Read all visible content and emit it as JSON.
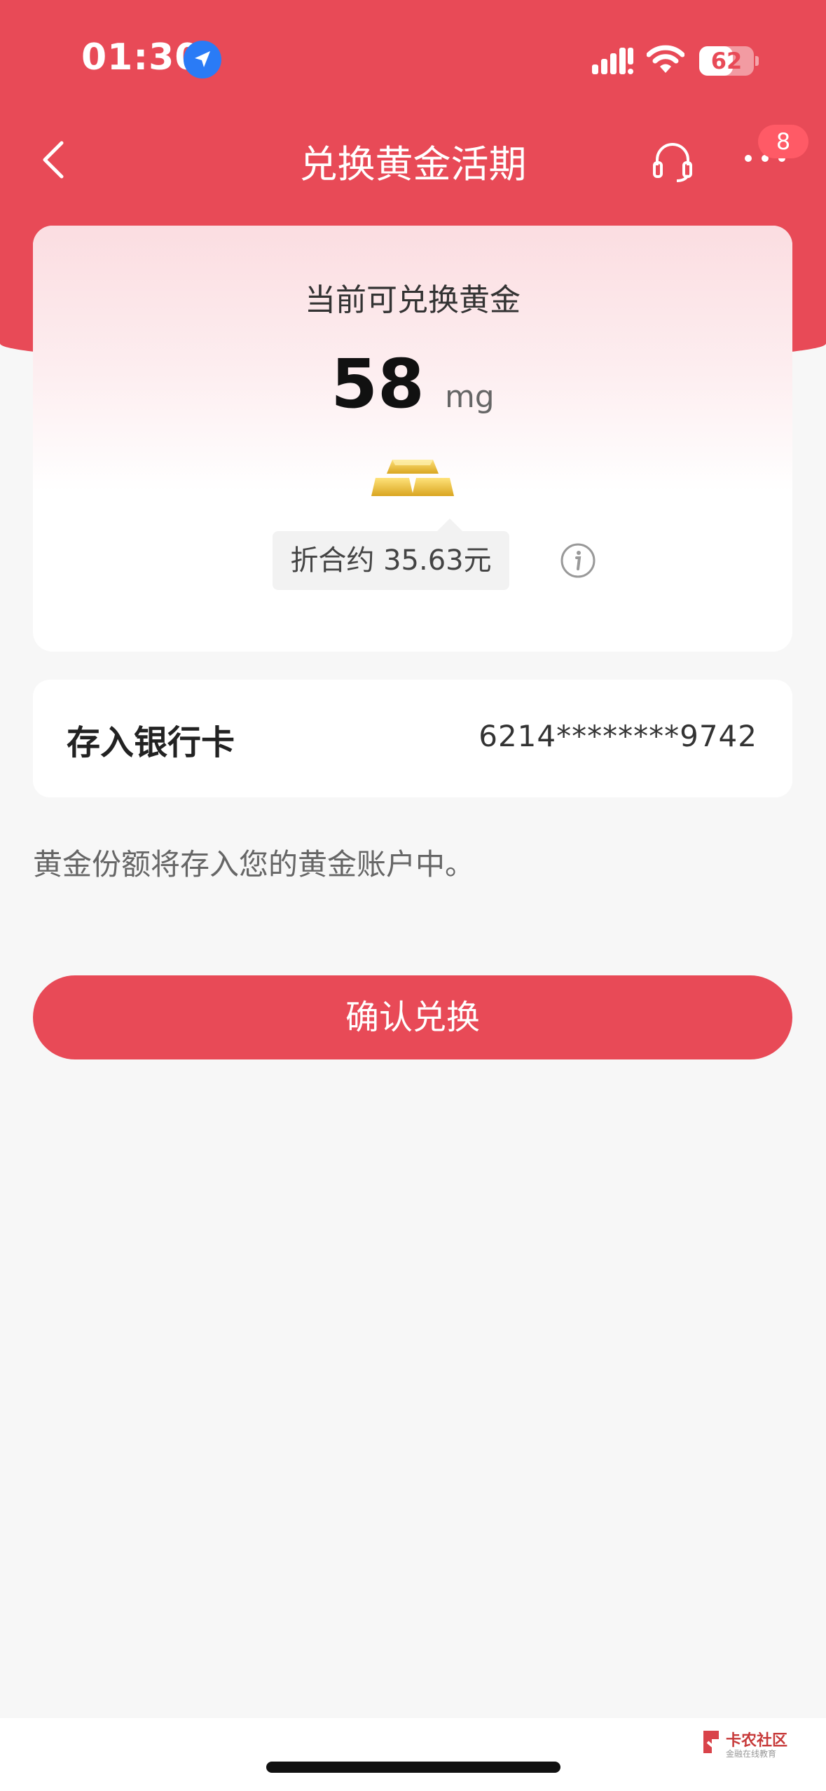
{
  "status_bar": {
    "time": "01:30",
    "battery": "62",
    "battery_level": 0.62
  },
  "nav": {
    "title": "兑换黄金活期",
    "badge_count": "8",
    "icons": [
      "back-arrow-icon",
      "headset-icon",
      "more-icon"
    ]
  },
  "gold_card": {
    "label": "当前可兑换黄金",
    "amount": "58",
    "unit": "mg",
    "conversion": "折合约 35.63元"
  },
  "bank": {
    "label": "存入银行卡",
    "card_number": "6214********9742"
  },
  "note": "黄金份额将存入您的黄金账户中。",
  "confirm_button": "确认兑换",
  "watermark": {
    "title": "卡农社区",
    "subtitle": "金融在线教育"
  },
  "colors": {
    "accent": "#e84a57",
    "background": "#f7f7f7",
    "card": "#ffffff"
  }
}
